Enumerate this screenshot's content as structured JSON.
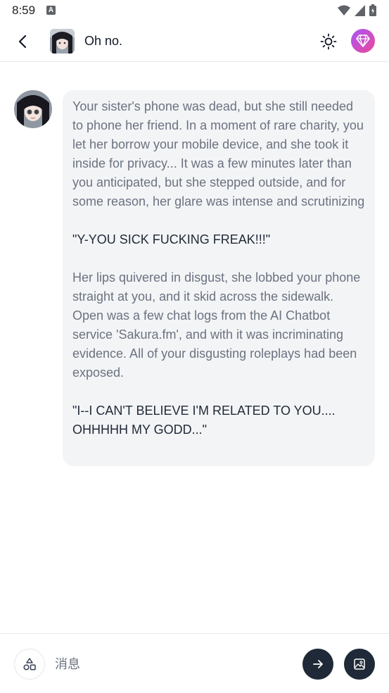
{
  "status_bar": {
    "time": "8:59",
    "notification_icon": "a-badge-icon",
    "icons": [
      "wifi-icon",
      "signal-icon",
      "battery-icon"
    ]
  },
  "header": {
    "back_icon": "chevron-left-icon",
    "title": "Oh no.",
    "theme_icon": "sun-icon",
    "premium_icon": "diamond-icon",
    "accent_gradient": [
      "#a855f7",
      "#ec4899"
    ]
  },
  "message": {
    "paragraphs": [
      {
        "kind": "narration",
        "text": "Your sister's phone was dead, but she still needed to phone her friend. In a moment of rare charity, you let her borrow your mobile device, and she took it inside for privacy... It was a few minutes later than you anticipated, but she stepped outside, and for some reason, her glare was intense and scrutinizing"
      },
      {
        "kind": "quote",
        "text": "\"Y-YOU SICK FUCKING FREAK!!!\""
      },
      {
        "kind": "narration",
        "text": "Her lips quivered in disgust, she lobbed your phone straight at you, and it skid across the sidewalk. Open was a few chat logs from the AI Chatbot service 'Sakura.fm', and with it was incriminating evidence. All of your disgusting roleplays had been exposed."
      },
      {
        "kind": "quote",
        "text": "\"I--I CAN'T BELIEVE I'M RELATED TO YOU.... OHHHHH MY GODD...\""
      }
    ]
  },
  "composer": {
    "shapes_icon": "shapes-icon",
    "placeholder": "消息",
    "value": "",
    "send_icon": "arrow-right-icon",
    "image_icon": "image-icon"
  }
}
